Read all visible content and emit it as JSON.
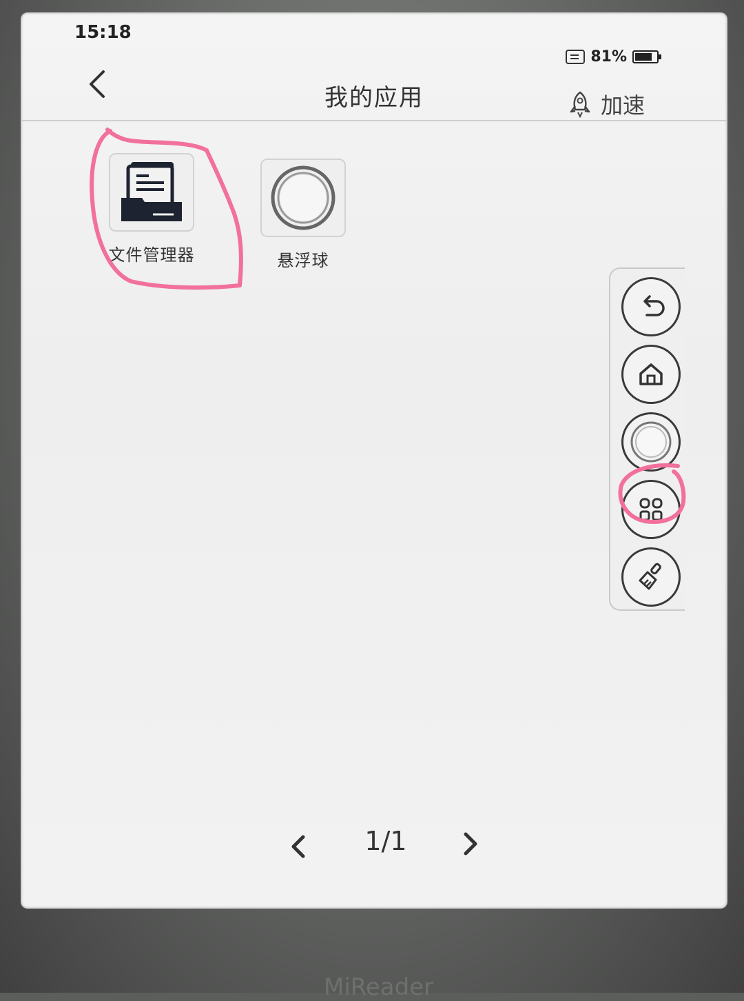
{
  "status_bar": {
    "time": "15:18",
    "battery": "81%"
  },
  "header": {
    "title": "我的应用",
    "boost_label": "加速"
  },
  "apps": [
    {
      "label": "文件管理器",
      "icon": "folder-documents-icon"
    },
    {
      "label": "悬浮球",
      "icon": "floating-ball-icon"
    }
  ],
  "floating_toolbar": [
    {
      "name": "back",
      "icon": "undo-arrow-icon"
    },
    {
      "name": "home",
      "icon": "home-icon"
    },
    {
      "name": "refresh",
      "icon": "circle-icon"
    },
    {
      "name": "apps",
      "icon": "apps-grid-icon"
    },
    {
      "name": "clean",
      "icon": "broom-icon"
    }
  ],
  "pagination": {
    "text": "1/1"
  },
  "device": {
    "brand": "MiReader"
  },
  "colors": {
    "annotation": "#f2709c"
  }
}
